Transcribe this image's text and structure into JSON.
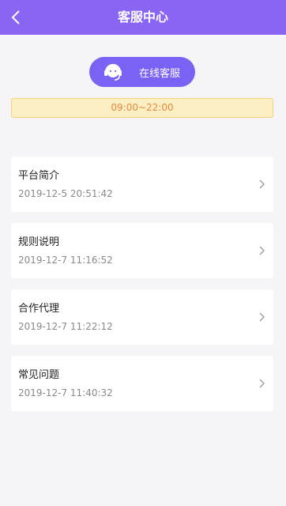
{
  "header": {
    "title": "客服中心"
  },
  "service": {
    "button_label": "在线客服",
    "hours": "09:00~22:00"
  },
  "list": [
    {
      "title": "平台简介",
      "date": "2019-12-5 20:51:42"
    },
    {
      "title": "规则说明",
      "date": "2019-12-7 11:16:52"
    },
    {
      "title": "合作代理",
      "date": "2019-12-7 11:22:12"
    },
    {
      "title": "常见问题",
      "date": "2019-12-7 11:40:32"
    }
  ],
  "colors": {
    "header": "#8a64f2",
    "button": "#7a62f4",
    "notice_bg": "#fdefc4",
    "notice_text": "#e8883b"
  }
}
